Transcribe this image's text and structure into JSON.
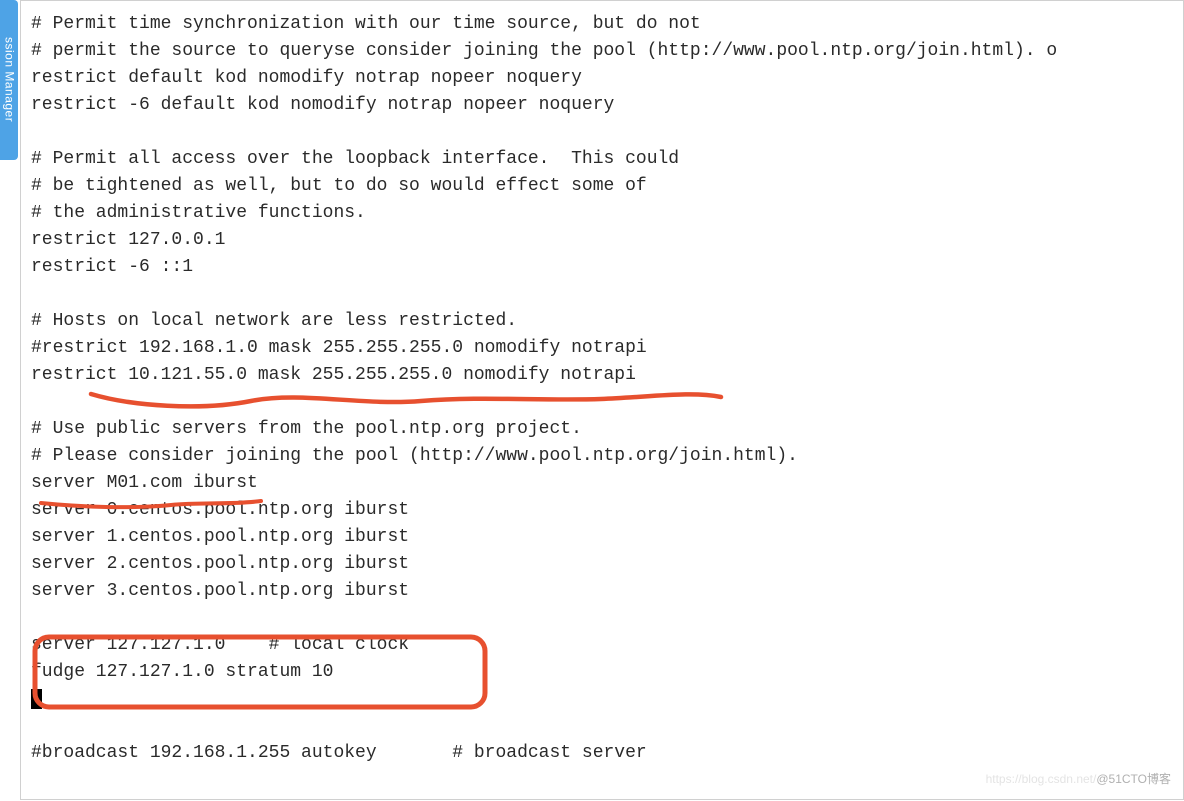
{
  "sidebar": {
    "label": "ssion Manager"
  },
  "lines": [
    "# Permit time synchronization with our time source, but do not",
    "# permit the source to queryse consider joining the pool (http://www.pool.ntp.org/join.html). o",
    "restrict default kod nomodify notrap nopeer noquery",
    "restrict -6 default kod nomodify notrap nopeer noquery",
    "",
    "# Permit all access over the loopback interface.  This could",
    "# be tightened as well, but to do so would effect some of",
    "# the administrative functions.",
    "restrict 127.0.0.1",
    "restrict -6 ::1",
    "",
    "# Hosts on local network are less restricted.",
    "#restrict 192.168.1.0 mask 255.255.255.0 nomodify notrapi",
    "restrict 10.121.55.0 mask 255.255.255.0 nomodify notrapi",
    "",
    "# Use public servers from the pool.ntp.org project.",
    "# Please consider joining the pool (http://www.pool.ntp.org/join.html).",
    "server M01.com iburst",
    "server 0.centos.pool.ntp.org iburst",
    "server 1.centos.pool.ntp.org iburst",
    "server 2.centos.pool.ntp.org iburst",
    "server 3.centos.pool.ntp.org iburst",
    "",
    "server 127.127.1.0    # local clock",
    "fudge 127.127.1.0 stratum 10",
    "",
    "#broadcast 192.168.1.255 autokey       # broadcast server"
  ],
  "cursor_after_line_index": 24,
  "watermark": {
    "faint": "https://blog.csdn.net/",
    "text": "@51CTO博客"
  }
}
